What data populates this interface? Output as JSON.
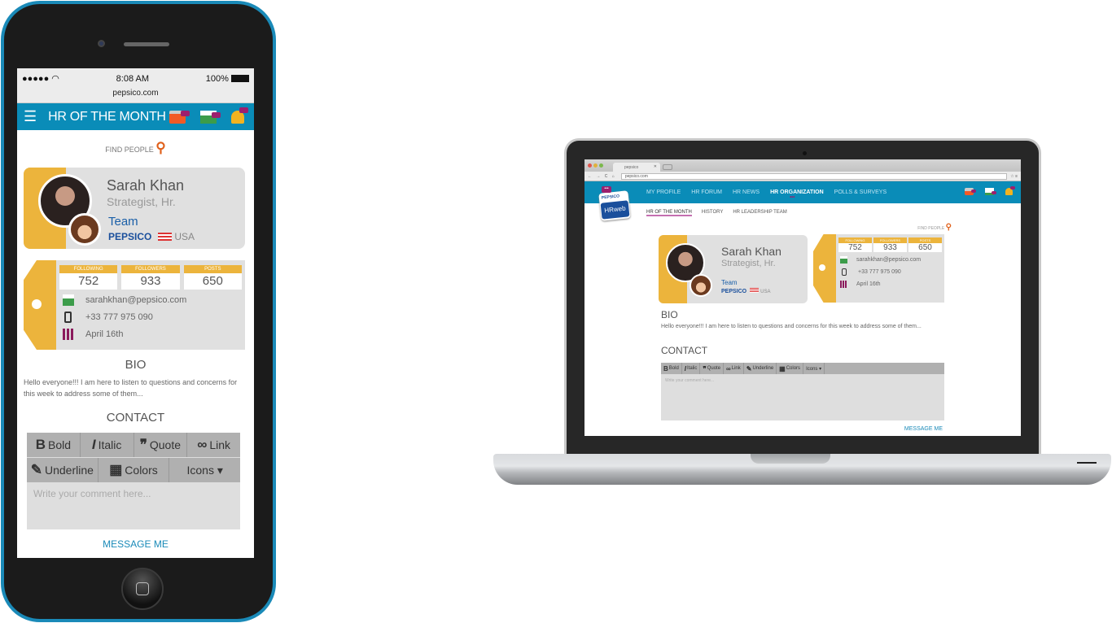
{
  "mobile": {
    "status_bar": {
      "signal": "●●●●● ",
      "wifi": "wifi-icon",
      "time": "8:08 AM",
      "battery": "100%"
    },
    "url": "pepsico.com",
    "nav": {
      "menu_icon": "☰",
      "title": "HR OF THE MONTH"
    },
    "find_people": "FIND PEOPLE"
  },
  "desktop": {
    "browser": {
      "tab_title": "pepsico",
      "url": "pepsico.com"
    },
    "nav_items": [
      "MY PROFILE",
      "HR FORUM",
      "HR NEWS",
      "HR ORGANIZATION",
      "POLLS & SURVEYS"
    ],
    "active_nav": "HR ORGANIZATION",
    "logo": {
      "brand": "PEPSICO",
      "product": "HRweb"
    },
    "sub_nav": [
      "HR OF THE MONTH",
      "HISTORY",
      "HR LEADERSHIP TEAM"
    ],
    "find_people": "FIND PEOPLE"
  },
  "profile": {
    "name": "Sarah Khan",
    "role": "Strategist, Hr.",
    "team_label": "Team",
    "company": "PEPSICO",
    "country": "USA",
    "stats": [
      {
        "label": "FOLLOWING",
        "value": "752"
      },
      {
        "label": "FOLLOWERS",
        "value": "933"
      },
      {
        "label": "POSTS",
        "value": "650"
      }
    ],
    "email": "sarahkhan@pepsico.com",
    "phone": "+33 777 975 090",
    "birthday": "April 16th"
  },
  "bio": {
    "heading": "BIO",
    "text": "Hello everyone!!! I am here to listen to questions and concerns for this week to address some of them..."
  },
  "contact": {
    "heading": "CONTACT",
    "toolbar": [
      {
        "glyph": "B",
        "label": "Bold"
      },
      {
        "glyph": "I",
        "label": "Italic"
      },
      {
        "glyph": "❞",
        "label": "Quote"
      },
      {
        "glyph": "🔗",
        "label": "Link"
      },
      {
        "glyph": "✎",
        "label": "Underline"
      },
      {
        "glyph": "▦",
        "label": "Colors"
      },
      {
        "glyph": "",
        "label": "Icons ▾"
      }
    ],
    "placeholder": "Write your comment here...",
    "submit_label": "MESSAGE ME"
  },
  "colors": {
    "brand_blue": "#0a8cb8",
    "gold": "#ecb43c",
    "accent_purple": "#9c1f6e",
    "pepsico_blue": "#1a4f9c"
  }
}
